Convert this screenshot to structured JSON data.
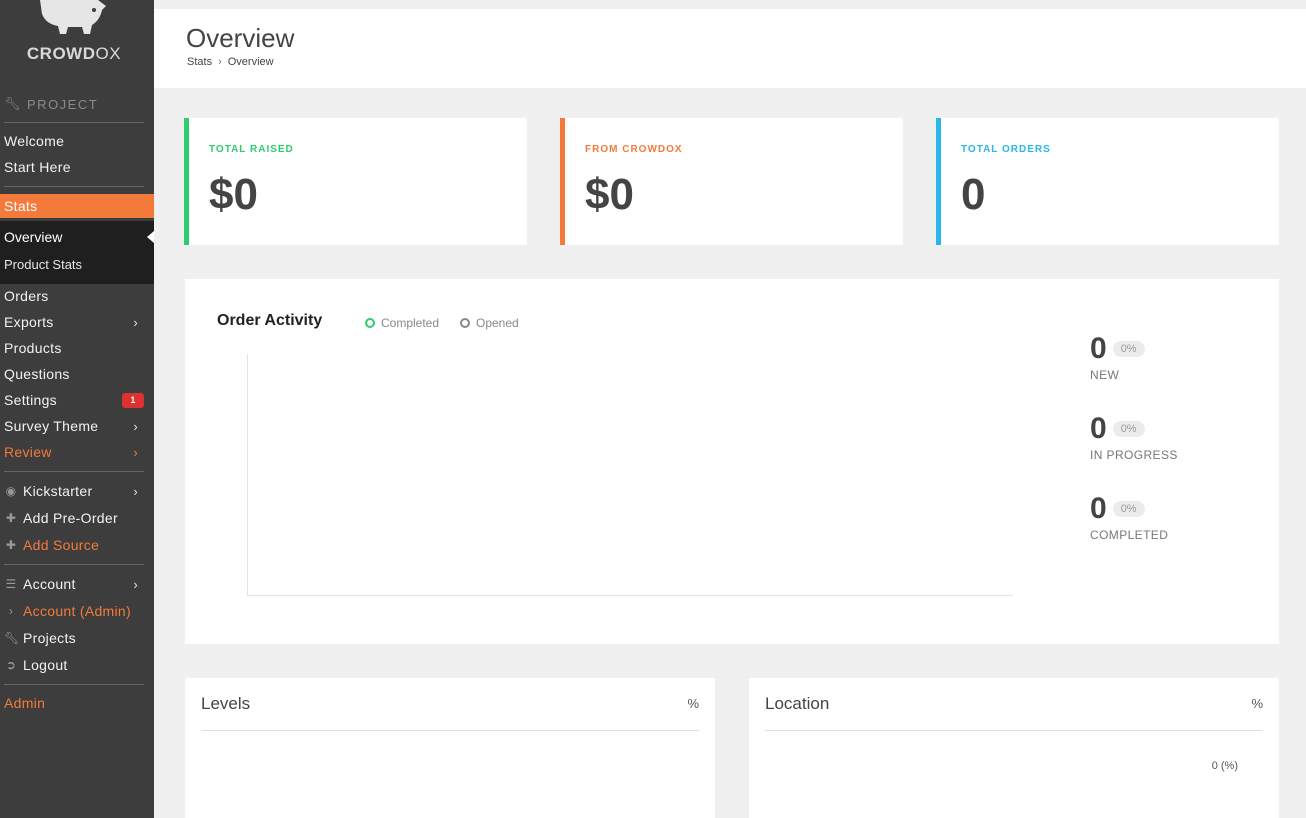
{
  "app": {
    "brand_bold": "CROWD",
    "brand_rest": "OX"
  },
  "sidebar": {
    "project_title": "PROJECT",
    "welcome": "Welcome",
    "start_here": "Start Here",
    "stats": "Stats",
    "overview": "Overview",
    "product_stats": "Product Stats",
    "orders": "Orders",
    "exports": "Exports",
    "products": "Products",
    "questions": "Questions",
    "settings": "Settings",
    "settings_badge": "1",
    "survey_theme": "Survey Theme",
    "review": "Review",
    "kickstarter": "Kickstarter",
    "add_pre_order": "Add Pre-Order",
    "add_source": "Add Source",
    "account": "Account",
    "account_admin": "Account (Admin)",
    "projects": "Projects",
    "logout": "Logout",
    "admin": "Admin",
    "accent_color": "#f47a3c"
  },
  "header": {
    "title": "Overview",
    "breadcrumb": [
      "Stats",
      "Overview"
    ]
  },
  "cards": [
    {
      "label": "TOTAL RAISED",
      "value": "$0",
      "color": "#2ecc71"
    },
    {
      "label": "FROM CROWDOX",
      "value": "$0",
      "color": "#f47a3c"
    },
    {
      "label": "TOTAL ORDERS",
      "value": "0",
      "color": "#29b6e8"
    }
  ],
  "activity": {
    "title": "Order Activity",
    "legend": [
      {
        "label": "Completed",
        "color": "#2ecc71"
      },
      {
        "label": "Opened",
        "color": "#888888"
      }
    ],
    "stats": [
      {
        "value": "0",
        "percent": "0%",
        "caption": "NEW"
      },
      {
        "value": "0",
        "percent": "0%",
        "caption": "IN PROGRESS"
      },
      {
        "value": "0",
        "percent": "0%",
        "caption": "COMPLETED"
      }
    ]
  },
  "levels": {
    "title": "Levels",
    "percent_header": "%"
  },
  "location": {
    "title": "Location",
    "percent_header": "%",
    "row_value": "0 (%)"
  }
}
